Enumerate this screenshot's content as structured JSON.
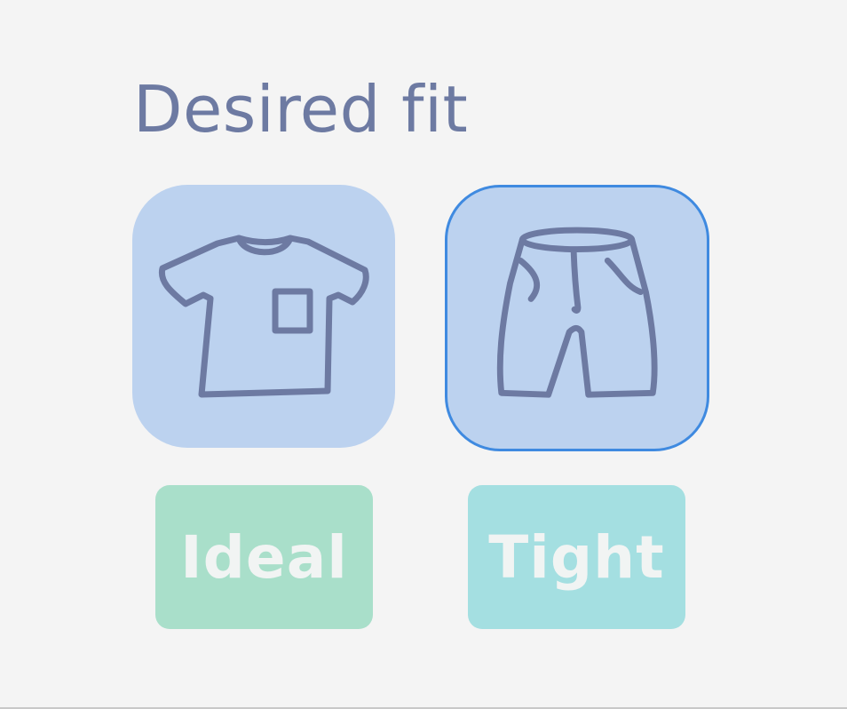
{
  "header": {
    "title": "Desired fit"
  },
  "garments": [
    {
      "icon": "t-shirt-icon",
      "selected": false
    },
    {
      "icon": "shorts-icon",
      "selected": true
    }
  ],
  "fit_options": [
    {
      "label": "Ideal",
      "color": "#a9dfca"
    },
    {
      "label": "Tight",
      "color": "#a4dfe1"
    }
  ],
  "colors": {
    "background": "#f4f4f4",
    "title": "#6d7aa2",
    "tile_fill": "#bcd2ef",
    "selected_border": "#3f8ae0",
    "icon_stroke": "#6d7aa2",
    "chip_text": "#f1f4f3"
  }
}
